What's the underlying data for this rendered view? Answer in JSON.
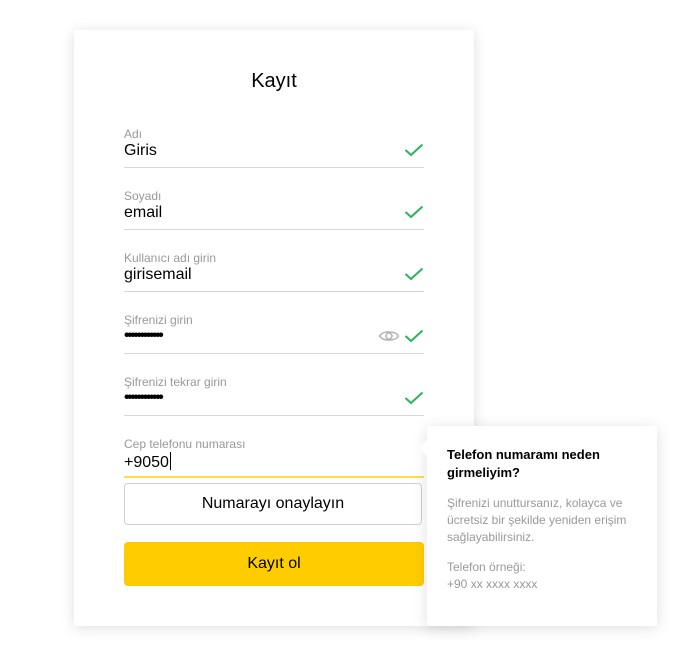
{
  "form": {
    "title": "Kayıt",
    "fields": [
      {
        "label": "Adı",
        "value": "Giris"
      },
      {
        "label": "Soyadı",
        "value": "email"
      },
      {
        "label": "Kullanıcı adı girin",
        "value": "girisemail"
      },
      {
        "label": "Şifrenizi girin",
        "value": "••••••••••••"
      },
      {
        "label": "Şifrenizi tekrar girin",
        "value": "••••••••••••"
      },
      {
        "label": "Cep telefonu numarası",
        "value": "+9050"
      }
    ],
    "confirm_label": "Numarayı onaylayın",
    "register_label": "Kayıt ol"
  },
  "tooltip": {
    "heading": "Telefon numaramı neden girmeliyim?",
    "body": "Şifrenizi unuttursanız, kolayca ve ücretsiz bir şekilde yeniden erişim sağlayabilirsiniz.",
    "example_label": "Telefon örneği:",
    "example_value": "+90 xx xxxx xxxx"
  },
  "colors": {
    "accent": "#ffcc00",
    "check": "#2eb35a",
    "active_underline": "#ffdb4d"
  },
  "icons": {
    "valid": "check-icon",
    "show_password": "eye-icon"
  }
}
